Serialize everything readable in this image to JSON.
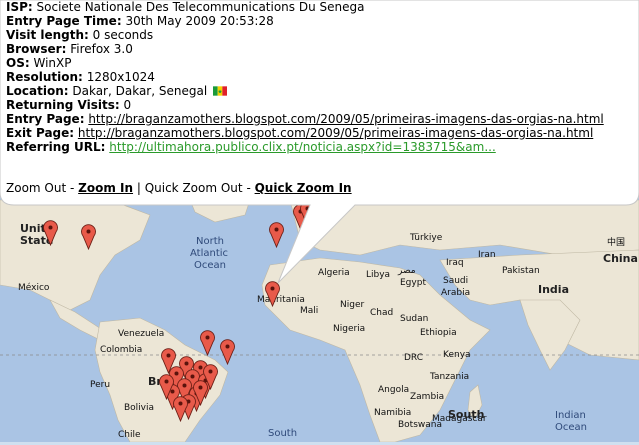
{
  "visitor": {
    "isp_label": "ISP:",
    "isp": "Societe Nationale Des Telecommunications Du Senega",
    "entry_time_label": "Entry Page Time:",
    "entry_time": "30th May 2009 20:53:28",
    "visit_length_label": "Visit length:",
    "visit_length": "0 seconds",
    "browser_label": "Browser:",
    "browser": "Firefox 3.0",
    "os_label": "OS:",
    "os": "WinXP",
    "resolution_label": "Resolution:",
    "resolution": "1280x1024",
    "location_label": "Location:",
    "location": "Dakar, Dakar, Senegal",
    "returning_label": "Returning Visits:",
    "returning": "0",
    "entry_page_label": "Entry Page:",
    "entry_page": "http://braganzamothers.blogspot.com/2009/05/primeiras-imagens-das-orgias-na.html",
    "exit_page_label": "Exit Page:",
    "exit_page": "http://braganzamothers.blogspot.com/2009/05/primeiras-imagens-das-orgias-na.html",
    "referring_label": "Referring URL:",
    "referring_url": "http://ultimahora.publico.clix.pt/noticia.aspx?id=1383715&am..."
  },
  "zoom": {
    "zoom_out": "Zoom Out",
    "sep1": " - ",
    "zoom_in": "Zoom In",
    "sep2": " | ",
    "quick_zoom_out": "Quick Zoom Out",
    "sep3": " - ",
    "quick_zoom_in": "Quick Zoom In"
  },
  "map_labels": {
    "north_atlantic": "North",
    "north_atlantic_2": "Atlantic",
    "north_atlantic_3": "Ocean",
    "south": "South",
    "indian": "Indian",
    "indian_2": "Ocean",
    "united_states": "Unit",
    "united_states_2": "State",
    "mexico": "México",
    "venezuela": "Venezuela",
    "colombia": "Colombia",
    "peru": "Peru",
    "bolivia": "Bolivia",
    "chile": "Chile",
    "brazil": "Bra",
    "algeria": "Algeria",
    "libya": "Libya",
    "egypt_ar": "مصر",
    "egypt": "Egypt",
    "mauritania": "Mauritania",
    "mali": "Mali",
    "niger": "Niger",
    "sudan": "Sudan",
    "chad": "Chad",
    "nigeria": "Nigeria",
    "ethiopia": "Ethiopia",
    "kenya": "Kenya",
    "tanzania": "Tanzania",
    "drc": "DRC",
    "angola": "Angola",
    "zambia": "Zambia",
    "namibia": "Namibia",
    "botswana": "Botswana",
    "madagascar": "Madagascar",
    "turkey": "Türkiye",
    "iraq": "Iraq",
    "iran": "Iran",
    "saudi": "Saudi",
    "saudi_2": "Arabia",
    "pakistan": "Pakistan",
    "india": "India",
    "china_cn": "中国",
    "china": "China",
    "south_africa": "South"
  },
  "colors": {
    "ocean": "#aac4e4",
    "land": "#ece6d6",
    "pin": "#e85a4a",
    "link_green": "#2a9a2a"
  }
}
